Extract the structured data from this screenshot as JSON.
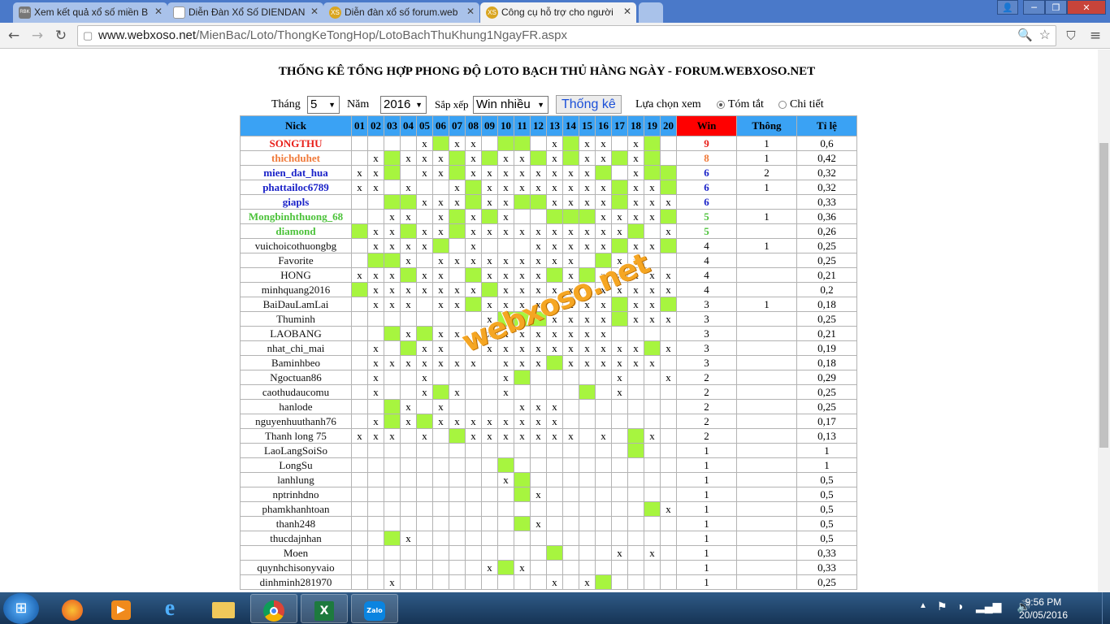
{
  "browser": {
    "tabs": [
      {
        "favicon": "RBK",
        "title": "Xem kết quả xổ số miền B"
      },
      {
        "favicon": "doc",
        "title": "Diễn Đàn Xổ Số DIENDAN"
      },
      {
        "favicon": "XS",
        "title": "Diễn đàn xổ số forum.web"
      },
      {
        "favicon": "XS",
        "title": "Công cụ hỗ trợ cho người"
      }
    ],
    "url_host": "www.webxoso.net",
    "url_path": "/MienBac/Loto/ThongKeTongHop/LotoBachThuKhung1NgayFR.aspx"
  },
  "page": {
    "title": "THỐNG KÊ TỔNG HỢP PHONG ĐỘ LOTO BẠCH THỦ HÀNG NGÀY - FORUM.WEBXOSO.NET",
    "filters": {
      "month_label": "Tháng",
      "month_value": "5",
      "year_label": "Năm",
      "year_value": "2016",
      "sort_label": "Sắp xếp",
      "sort_value": "Win nhiều",
      "submit_label": "Thống kê",
      "view_label": "Lựa chọn xem",
      "view_summary": "Tóm tắt",
      "view_detail": "Chi tiết",
      "view_selected": "summary"
    },
    "watermark": "webxoso.net"
  },
  "colors": {
    "header_bg": "#3aa2f4",
    "win_header_bg": "#ff0000",
    "hit_cell": "#a7f53f",
    "rank1": "#e8201a",
    "rank2": "#f07a3a",
    "rank3": "#1a22c8",
    "rank4": "#4cc23a"
  },
  "table": {
    "headers": {
      "nick": "Nick",
      "days": [
        "01",
        "02",
        "03",
        "04",
        "05",
        "06",
        "07",
        "08",
        "09",
        "10",
        "11",
        "12",
        "13",
        "14",
        "15",
        "16",
        "17",
        "18",
        "19",
        "20"
      ],
      "win": "Win",
      "thong": "Thông",
      "ratio": "Tỉ lệ"
    },
    "rows": [
      {
        "nick": "SONGTHU",
        "color": "#e8201a",
        "bold": true,
        "cells": "....xgxx.gg.xgxx.xg..x.",
        "win": "9",
        "thong": "1",
        "ratio": "0,6"
      },
      {
        "nick": "thichduhet",
        "color": "#f07a3a",
        "bold": true,
        "cells": ".xgxxxgxgxxgxgxxgxg",
        "win": "8",
        "thong": "1",
        "ratio": "0,42"
      },
      {
        "nick": "mien_dat_hua",
        "color": "#1a22c8",
        "bold": true,
        "cells": "xxg.xxgxxxxxxxxg.xgg",
        "win": "6",
        "thong": "2",
        "ratio": "0,32"
      },
      {
        "nick": "phattailoc6789",
        "color": "#1a22c8",
        "bold": true,
        "cells": "xx.x..xgxxxxxxxxgxxg",
        "win": "6",
        "thong": "1",
        "ratio": "0,32"
      },
      {
        "nick": "giapls",
        "color": "#1a22c8",
        "bold": true,
        "cells": "..ggxxxgxxggxxxxgxxx",
        "win": "6",
        "thong": "",
        "ratio": "0,33"
      },
      {
        "nick": "Mongbinhthuong_68",
        "color": "#4cc23a",
        "bold": true,
        "cells": "..xx.xgxgx..gggxxxxg",
        "win": "5",
        "thong": "1",
        "ratio": "0,36"
      },
      {
        "nick": "diamond",
        "color": "#4cc23a",
        "bold": true,
        "cells": "gxxgxxgxxxxxxxxxxg.x",
        "win": "5",
        "thong": "",
        "ratio": "0,26"
      },
      {
        "nick": "vuichoicothuongbg",
        "color": "#111",
        "bold": false,
        "cells": ".xxxxg.x...xxxxxgxxg",
        "win": "4",
        "thong": "1",
        "ratio": "0,25"
      },
      {
        "nick": "Favorite",
        "color": "#111",
        "bold": false,
        "cells": ".ggx.xxxxxxxxx.gxx..",
        "win": "4",
        "thong": "",
        "ratio": "0,25"
      },
      {
        "nick": "HONG",
        "color": "#111",
        "bold": false,
        "cells": "xxxgxx.gxxxxgxgxxxxx",
        "win": "4",
        "thong": "",
        "ratio": "0,21"
      },
      {
        "nick": "minhquang2016",
        "color": "#111",
        "bold": false,
        "cells": "gxxxxxxxgxxxxxxxxxxx",
        "win": "4",
        "thong": "",
        "ratio": "0,2"
      },
      {
        "nick": "BaiDauLamLai",
        "color": "#111",
        "bold": false,
        "cells": ".xxx.xxgxxxxxxxxgxxg",
        "win": "3",
        "thong": "1",
        "ratio": "0,18"
      },
      {
        "nick": "Thuminh",
        "color": "#111",
        "bold": false,
        "cells": "........xgggxxxxgxxx",
        "win": "3",
        "thong": "",
        "ratio": "0,25"
      },
      {
        "nick": "LAOBANG",
        "color": "#111",
        "bold": false,
        "cells": "..gxgxxxxxxxxxxx....",
        "win": "3",
        "thong": "",
        "ratio": "0,21"
      },
      {
        "nick": "nhat_chi_mai",
        "color": "#111",
        "bold": false,
        "cells": ".x.gxx..xxxxxxxxxxgx",
        "win": "3",
        "thong": "",
        "ratio": "0,19"
      },
      {
        "nick": "Baminhbeo",
        "color": "#111",
        "bold": false,
        "cells": ".xxxxxxx.xxxgxxxxxx.",
        "win": "3",
        "thong": "",
        "ratio": "0,18"
      },
      {
        "nick": "Ngoctuan86",
        "color": "#111",
        "bold": false,
        "cells": ".x..x....xg.....x..x",
        "win": "2",
        "thong": "",
        "ratio": "0,29"
      },
      {
        "nick": "caothudaucomu",
        "color": "#111",
        "bold": false,
        "cells": ".x..xgx..x....g.x...",
        "win": "2",
        "thong": "",
        "ratio": "0,25"
      },
      {
        "nick": "hanlode",
        "color": "#111",
        "bold": false,
        "cells": "..gx.x....xxx.......",
        "win": "2",
        "thong": "",
        "ratio": "0,25"
      },
      {
        "nick": "nguyenhuuthanh76",
        "color": "#111",
        "bold": false,
        "cells": ".xgxgxxxxxxxx.......",
        "win": "2",
        "thong": "",
        "ratio": "0,17"
      },
      {
        "nick": "Thanh long 75",
        "color": "#111",
        "bold": false,
        "cells": "xxx.x.gxxxxxxx.x.gx.",
        "win": "2",
        "thong": "",
        "ratio": "0,13"
      },
      {
        "nick": "LaoLangSoiSo",
        "color": "#111",
        "bold": false,
        "cells": ".................g..",
        "win": "1",
        "thong": "",
        "ratio": "1"
      },
      {
        "nick": "LongSu",
        "color": "#111",
        "bold": false,
        "cells": ".........g..........",
        "win": "1",
        "thong": "",
        "ratio": "1"
      },
      {
        "nick": "lanhlung",
        "color": "#111",
        "bold": false,
        "cells": ".........xg.........",
        "win": "1",
        "thong": "",
        "ratio": "0,5"
      },
      {
        "nick": "nptrinhdno",
        "color": "#111",
        "bold": false,
        "cells": "..........gx........",
        "win": "1",
        "thong": "",
        "ratio": "0,5"
      },
      {
        "nick": "phamkhanhtoan",
        "color": "#111",
        "bold": false,
        "cells": "..................gx",
        "win": "1",
        "thong": "",
        "ratio": "0,5"
      },
      {
        "nick": "thanh248",
        "color": "#111",
        "bold": false,
        "cells": "..........gx........",
        "win": "1",
        "thong": "",
        "ratio": "0,5"
      },
      {
        "nick": "thucdajnhan",
        "color": "#111",
        "bold": false,
        "cells": "..gx................",
        "win": "1",
        "thong": "",
        "ratio": "0,5"
      },
      {
        "nick": "Moen",
        "color": "#111",
        "bold": false,
        "cells": "............g...x.x.",
        "win": "1",
        "thong": "",
        "ratio": "0,33"
      },
      {
        "nick": "quynhchisonyvaio",
        "color": "#111",
        "bold": false,
        "cells": "........xgx.........",
        "win": "1",
        "thong": "",
        "ratio": "0,33"
      },
      {
        "nick": "dinhminh281970",
        "color": "#111",
        "bold": false,
        "cells": "..x.........x.xg....",
        "win": "1",
        "thong": "",
        "ratio": "0,25"
      }
    ]
  },
  "taskbar": {
    "time": "9:56 PM",
    "date": "20/05/2016",
    "apps": [
      "firefox-icon",
      "media-player-icon",
      "ie-icon",
      "explorer-icon",
      "chrome-icon",
      "excel-icon",
      "zalo-icon"
    ]
  }
}
